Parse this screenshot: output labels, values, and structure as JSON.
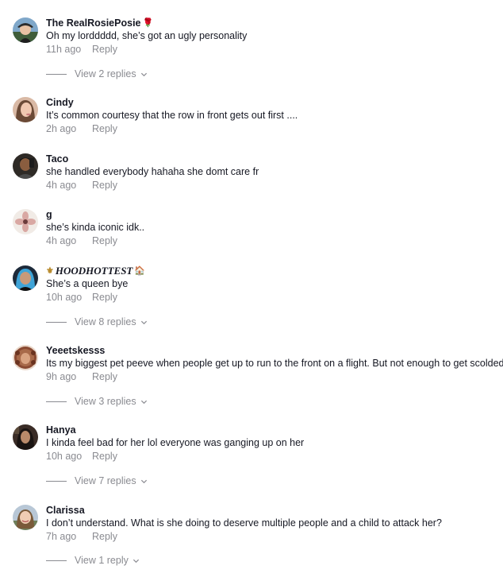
{
  "comments": [
    {
      "username": "The RealRosiePosie",
      "username_emoji": "🌹",
      "text": "Oh my lorddddd, she’s got an ugly personality",
      "time": "11h ago",
      "reply_label": "Reply",
      "view_replies": "View 2 replies",
      "avatar": "avatar-photo-person-with-hat"
    },
    {
      "username": "Cindy",
      "text": "It’s common courtesy that the row in front gets out first ....",
      "time": "2h ago",
      "reply_label": "Reply",
      "avatar": "avatar-photo-woman"
    },
    {
      "username": "Taco",
      "text": "she handled everybody hahaha she domt care fr",
      "time": "4h ago",
      "reply_label": "Reply",
      "avatar": "avatar-photo-man"
    },
    {
      "username": "g",
      "text": "she’s kinda iconic idk..",
      "time": "4h ago",
      "reply_label": "Reply",
      "avatar": "avatar-pink-flower"
    },
    {
      "username": "HOODHOTTEST",
      "username_prefix_emoji": "⚜",
      "username_suffix_emoji": "🏠",
      "text": "She’s a queen bye",
      "time": "10h ago",
      "reply_label": "Reply",
      "view_replies": "View 8 replies",
      "avatar": "avatar-photo-woman-blue-hair"
    },
    {
      "username": "Yeeetskesss",
      "text": "Its my biggest pet peeve when people get up to run to the front on a flight. But not enough to get scolded.",
      "time": "9h ago",
      "reply_label": "Reply",
      "view_replies": "View 3 replies",
      "avatar": "avatar-photo-woman-curly-hair"
    },
    {
      "username": "Hanya",
      "text": "I kinda feel bad for her lol everyone was ganging up on her",
      "time": "10h ago",
      "reply_label": "Reply",
      "view_replies": "View 7 replies",
      "avatar": "avatar-photo-woman-dark"
    },
    {
      "username": "Clarissa",
      "text": "I don’t understand. What is she doing to deserve multiple people and a child to attack her?",
      "time": "7h ago",
      "reply_label": "Reply",
      "view_replies": "View 1 reply",
      "avatar": "avatar-photo-woman-smiling"
    }
  ],
  "colors": {
    "text": "#161823",
    "muted": "#8a8b91",
    "background": "#ffffff"
  }
}
